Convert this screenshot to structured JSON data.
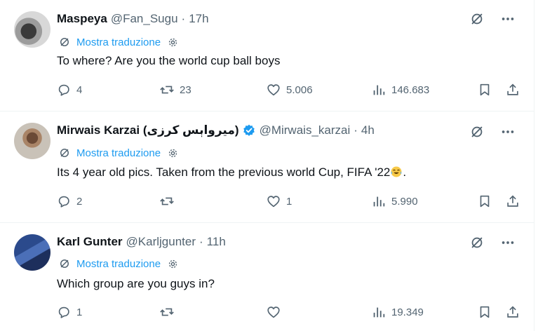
{
  "tweets": [
    {
      "name": "Maspeya",
      "handle": "@Fan_Sugu",
      "separator": "·",
      "time": "17h",
      "translate_label": "Mostra traduzione",
      "text": "To where? Are you the world cup ball boys",
      "replies": "4",
      "retweets": "23",
      "likes": "5.006",
      "views": "146.683",
      "verified": false,
      "avatar": "grey-photo"
    },
    {
      "name": "Mirwais Karzai (میرواېس کرزی)",
      "handle": "@Mirwais_karzai",
      "separator": "·",
      "time": "4h",
      "translate_label": "Mostra traduzione",
      "text": "Its 4 year old pics. Taken from the previous world Cup, FIFA '22",
      "text_suffix": ".",
      "replies": "2",
      "retweets": "",
      "likes": "1",
      "views": "5.990",
      "verified": true,
      "avatar": "man-photo"
    },
    {
      "name": "Karl Gunter",
      "handle": "@Karljgunter",
      "separator": "·",
      "time": "11h",
      "translate_label": "Mostra traduzione",
      "text": "Which group are you guys in?",
      "replies": "1",
      "retweets": "",
      "likes": "",
      "views": "19.349",
      "verified": false,
      "avatar": "blue-photo"
    }
  ],
  "colors": {
    "link": "#1d9bf0",
    "muted": "#536471",
    "text": "#0f1419",
    "divider": "#eff3f4"
  },
  "icons": {
    "reply": "reply-bubble-icon",
    "retweet": "retweet-icon",
    "like": "heart-icon",
    "views": "views-bar-chart-icon",
    "bookmark": "bookmark-icon",
    "share": "share-upload-icon",
    "more": "more-dots-icon",
    "grok": "grok-icon",
    "translate": "translate-icon",
    "settings": "gear-icon",
    "verified": "verified-badge-icon"
  }
}
